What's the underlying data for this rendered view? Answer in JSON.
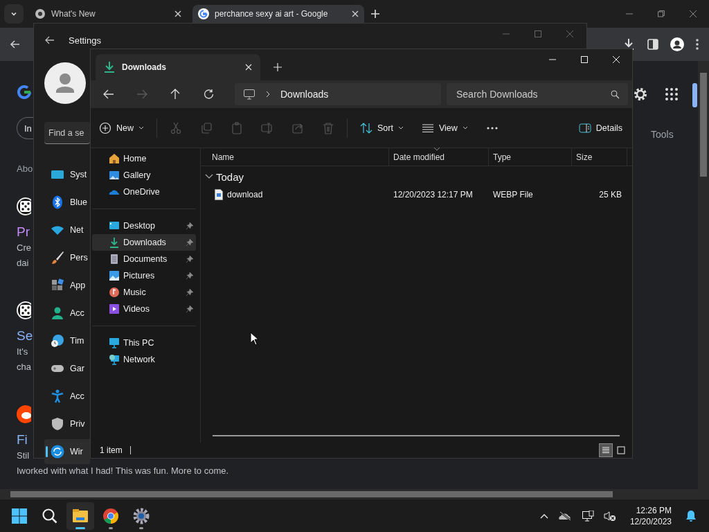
{
  "browser": {
    "tabs": [
      {
        "kind": "chrome",
        "title": "What's New",
        "selected": false
      },
      {
        "kind": "google",
        "title": "perchance sexy ai art - Google",
        "selected": true
      }
    ],
    "page": {
      "chip": "In",
      "about": "Abo",
      "tools": "Tools",
      "results": [
        {
          "kind": "dice",
          "title": "Pr",
          "visited": true,
          "lines": [
            "Cre",
            "dai"
          ]
        },
        {
          "kind": "dice",
          "title": "Se",
          "visited": false,
          "lines": [
            "It's",
            "cha"
          ]
        },
        {
          "kind": "reddit",
          "title": "Fi",
          "visited": false,
          "lines": [
            "Stil"
          ]
        }
      ],
      "footer": "Iworked with what I had! This was fun. More to come."
    }
  },
  "settings": {
    "title": "Settings",
    "search": {
      "placeholder": "Find a se"
    },
    "nav": [
      {
        "kind": "system",
        "label": "Syst",
        "selected": false
      },
      {
        "kind": "bluetooth",
        "label": "Blue",
        "selected": false
      },
      {
        "kind": "network",
        "label": "Net",
        "selected": false
      },
      {
        "kind": "personalization",
        "label": "Pers",
        "selected": false
      },
      {
        "kind": "apps",
        "label": "App",
        "selected": false
      },
      {
        "kind": "accounts",
        "label": "Acc",
        "selected": false
      },
      {
        "kind": "time",
        "label": "Tim",
        "selected": false
      },
      {
        "kind": "gaming",
        "label": "Gar",
        "selected": false
      },
      {
        "kind": "accessibility",
        "label": "Acc",
        "selected": false
      },
      {
        "kind": "privacy",
        "label": "Priv",
        "selected": false
      },
      {
        "kind": "update",
        "label": "Wir",
        "selected": true
      }
    ]
  },
  "explorer": {
    "tab": {
      "title": "Downloads"
    },
    "nav": [
      {
        "kind": "back",
        "disabled": false
      },
      {
        "kind": "forward",
        "disabled": true
      },
      {
        "kind": "up",
        "disabled": false
      },
      {
        "kind": "refresh",
        "disabled": false
      }
    ],
    "address": {
      "crumbs": [
        "Downloads"
      ]
    },
    "search": {
      "placeholder": "Search Downloads"
    },
    "commands": [
      {
        "kind": "new",
        "label": "New",
        "dropdown": true,
        "disabled": false
      },
      {
        "kind": "cut",
        "disabled": true
      },
      {
        "kind": "copy",
        "disabled": true
      },
      {
        "kind": "paste",
        "disabled": true
      },
      {
        "kind": "rename",
        "disabled": true
      },
      {
        "kind": "share",
        "disabled": true
      },
      {
        "kind": "delete",
        "disabled": true
      },
      {
        "kind": "sort",
        "label": "Sort",
        "dropdown": true,
        "disabled": false
      },
      {
        "kind": "view",
        "label": "View",
        "dropdown": true,
        "disabled": false
      },
      {
        "kind": "more",
        "disabled": false
      }
    ],
    "details": {
      "label": "Details"
    },
    "sidebar": [
      {
        "items": [
          {
            "kind": "home",
            "label": "Home",
            "pinned": false,
            "selected": false
          },
          {
            "kind": "gallery",
            "label": "Gallery",
            "pinned": false,
            "selected": false
          },
          {
            "kind": "onedrive",
            "label": "OneDrive",
            "pinned": false,
            "selected": false
          }
        ]
      },
      {
        "items": [
          {
            "kind": "desktop",
            "label": "Desktop",
            "pinned": true,
            "selected": false
          },
          {
            "kind": "downloads",
            "label": "Downloads",
            "pinned": true,
            "selected": true
          },
          {
            "kind": "documents",
            "label": "Documents",
            "pinned": true,
            "selected": false
          },
          {
            "kind": "pictures",
            "label": "Pictures",
            "pinned": true,
            "selected": false
          },
          {
            "kind": "music",
            "label": "Music",
            "pinned": true,
            "selected": false
          },
          {
            "kind": "videos",
            "label": "Videos",
            "pinned": true,
            "selected": false
          }
        ]
      },
      {
        "items": [
          {
            "kind": "thispc",
            "label": "This PC",
            "pinned": false,
            "selected": false
          },
          {
            "kind": "network",
            "label": "Network",
            "pinned": false,
            "selected": false
          }
        ]
      }
    ],
    "columns": [
      {
        "label": "Name",
        "sorted": false
      },
      {
        "label": "Date modified",
        "sorted": true
      },
      {
        "label": "Type",
        "sorted": false
      },
      {
        "label": "Size",
        "sorted": false
      }
    ],
    "groups": [
      {
        "label": "Today",
        "expanded": true,
        "rows": [
          {
            "name": "download",
            "date": "12/20/2023 12:17 PM",
            "type": "WEBP File",
            "size": "25 KB",
            "selected": false
          }
        ]
      }
    ],
    "status": "1 item",
    "view_modes": [
      {
        "kind": "details",
        "selected": true
      },
      {
        "kind": "tiles",
        "selected": false
      }
    ]
  },
  "taskbar": {
    "apps": [
      {
        "kind": "start",
        "running": false,
        "active": false
      },
      {
        "kind": "search",
        "running": false,
        "active": false
      },
      {
        "kind": "explorer",
        "running": true,
        "active": true
      },
      {
        "kind": "chrome",
        "running": true,
        "active": false
      },
      {
        "kind": "settings",
        "running": true,
        "active": false
      }
    ],
    "time": "12:26 PM",
    "date": "12/20/2023"
  }
}
